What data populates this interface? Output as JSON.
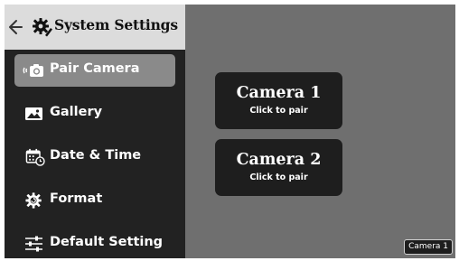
{
  "header": {
    "back_icon": "arrow-left-icon",
    "gear_icon": "gear-icon",
    "title": "System Settings"
  },
  "sidebar": {
    "items": [
      {
        "label": "Pair Camera",
        "icon": "camera-signal-icon",
        "active": true
      },
      {
        "label": "Gallery",
        "icon": "image-icon",
        "active": false
      },
      {
        "label": "Date & Time",
        "icon": "calendar-clock-icon",
        "active": false
      },
      {
        "label": "Format",
        "icon": "format-gear-icon",
        "active": false
      },
      {
        "label": "Default Setting",
        "icon": "sliders-icon",
        "active": false
      }
    ]
  },
  "cameras": [
    {
      "name": "Camera 1",
      "action": "Click to pair"
    },
    {
      "name": "Camera 2",
      "action": "Click to pair"
    }
  ],
  "badge": {
    "label": "Camera 1"
  },
  "colors": {
    "background": "#6f6f6f",
    "sidebar": "#222222",
    "header": "#dcdcdc",
    "active_item": "#8a8a8a",
    "card": "#1e1e1e"
  }
}
